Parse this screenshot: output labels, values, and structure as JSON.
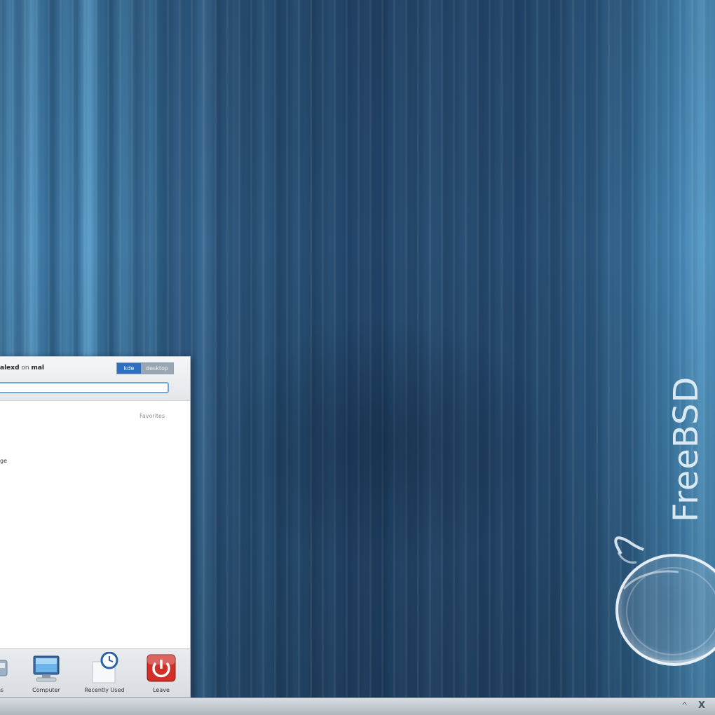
{
  "desktop": {
    "brand_text": "FreeBSD"
  },
  "launcher": {
    "header": {
      "user_name": "alexd",
      "user_sep": "on",
      "host_name": "mal",
      "badge_left": "kde",
      "badge_right": "desktop"
    },
    "search": {
      "value": "",
      "placeholder": ""
    },
    "favorites_label": "Favorites",
    "favorite_item": "ge",
    "tabs": [
      {
        "label": "ons",
        "icon": "applications-icon"
      },
      {
        "label": "Computer",
        "icon": "computer-icon"
      },
      {
        "label": "Recently Used",
        "icon": "recently-used-icon"
      },
      {
        "label": "Leave",
        "icon": "leave-icon"
      }
    ]
  },
  "taskbar": {
    "tray_up": "^",
    "tray_x": "X"
  },
  "colors": {
    "wallpaper": "#2b5575",
    "accent_blue": "#2f6fc0",
    "leave_red": "#d03028"
  }
}
